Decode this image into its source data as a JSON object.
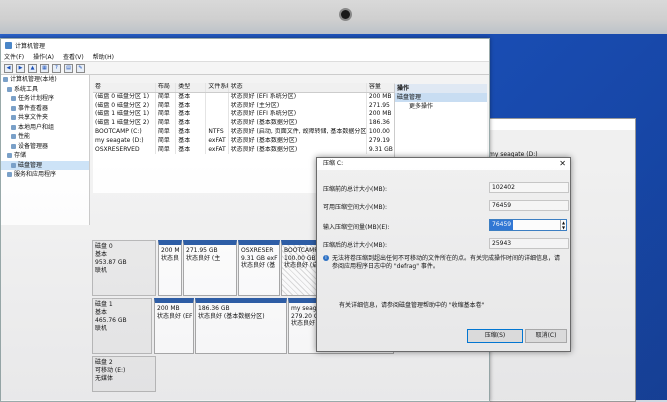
{
  "app": {
    "title": "计算机管理"
  },
  "menu": [
    "文件(F)",
    "操作(A)",
    "查看(V)",
    "帮助(H)"
  ],
  "tree": [
    {
      "label": "计算机管理(本地)"
    },
    {
      "label": "系统工具"
    },
    {
      "label": "任务计划程序"
    },
    {
      "label": "事件查看器"
    },
    {
      "label": "共享文件夹"
    },
    {
      "label": "本地用户和组"
    },
    {
      "label": "性能"
    },
    {
      "label": "设备管理器"
    },
    {
      "label": "存储"
    },
    {
      "label": "磁盘管理"
    },
    {
      "label": "服务和应用程序"
    }
  ],
  "volume_table": {
    "headers": [
      "卷",
      "布局",
      "类型",
      "文件系统",
      "状态",
      "容量"
    ],
    "rows": [
      [
        "(磁盘 0 磁盘分区 1)",
        "简单",
        "基本",
        "",
        "状态良好 (EFI 系统分区)",
        "200 MB"
      ],
      [
        "(磁盘 0 磁盘分区 2)",
        "简单",
        "基本",
        "",
        "状态良好 (主分区)",
        "271.95"
      ],
      [
        "(磁盘 1 磁盘分区 1)",
        "简单",
        "基本",
        "",
        "状态良好 (EFI 系统分区)",
        "200 MB"
      ],
      [
        "(磁盘 1 磁盘分区 2)",
        "简单",
        "基本",
        "",
        "状态良好 (基本数据分区)",
        "186.36"
      ],
      [
        "BOOTCAMP (C:)",
        "简单",
        "基本",
        "NTFS",
        "状态良好 (启动, 页面文件, 故障转储, 基本数据分区)",
        "100.00"
      ],
      [
        "my seagate (D:)",
        "简单",
        "基本",
        "exFAT",
        "状态良好 (基本数据分区)",
        "279.19"
      ],
      [
        "OSXRESERVED",
        "简单",
        "基本",
        "exFAT",
        "状态良好 (基本数据分区)",
        "9.31 GB"
      ]
    ]
  },
  "actions": {
    "header": "操作",
    "selected": "磁盘管理",
    "more": "更多操作"
  },
  "disk0": {
    "name": "磁盘 0",
    "type": "基本",
    "size": "953.87 GB",
    "status": "联机",
    "parts": [
      {
        "l1": "200 M",
        "l2": "状态良"
      },
      {
        "l1": "271.95 GB",
        "l2": "状态良好 (主"
      },
      {
        "l1": "OSXRESER",
        "l2": "9.31 GB exF",
        "l3": "状态良好 (基"
      },
      {
        "l1": "BOOTCAMP",
        "l2": "100.00 GB N",
        "l3": "状态良好 (启"
      },
      {
        "l1": "",
        "l2": "",
        "l3": ""
      }
    ]
  },
  "disk1": {
    "name": "磁盘 1",
    "type": "基本",
    "size": "465.76 GB",
    "status": "联机",
    "parts": [
      {
        "l1": "200 MB",
        "l2": "状态良好 (EFI"
      },
      {
        "l1": "186.36 GB",
        "l2": "状态良好 (基本数据分区)"
      },
      {
        "l1": "my seagat",
        "l2": "279.20 GB ex",
        "l3": "状态良好 (基本"
      }
    ]
  },
  "disk2": {
    "name": "磁盘 2",
    "type": "可移动 (E:)",
    "status": "无媒体"
  },
  "bg_window": {
    "text": "my seagate (D:)"
  },
  "dialog": {
    "title": "压缩 C:",
    "total_label": "压缩前的总计大小(MB):",
    "total_value": "102402",
    "avail_label": "可用压缩空间大小(MB):",
    "avail_value": "76459",
    "input_label": "输入压缩空间量(MB)(E):",
    "input_value": "76459",
    "after_label": "压缩后的总计大小(MB):",
    "after_value": "25943",
    "info": "无法将卷压缩到超出任何不可移动的文件所在的点。有关完成操作时间的详细信息，请参阅应用程序日志中的 \"defrag\" 事件。",
    "link": "有关详细信息，请参阅磁盘管理帮助中的 \"收缩基本卷\"",
    "ok": "压缩(S)",
    "cancel": "取消(C)"
  }
}
